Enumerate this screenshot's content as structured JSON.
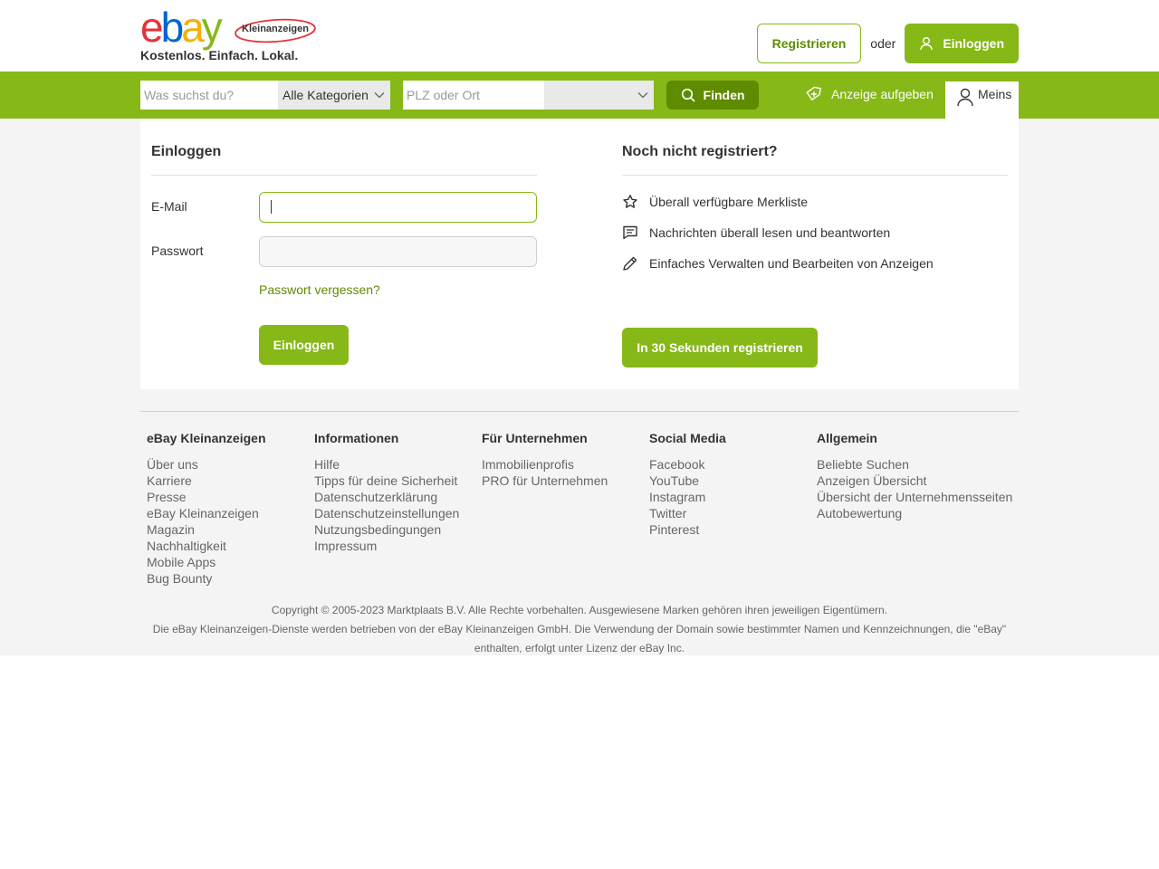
{
  "header": {
    "logo_text": [
      "e",
      "b",
      "a",
      "y"
    ],
    "logo_badge": "Kleinanzeigen",
    "tagline": "Kostenlos. Einfach. Lokal.",
    "register_label": "Registrieren",
    "or_label": "oder",
    "login_label": "Einloggen"
  },
  "nav": {
    "search_placeholder": "Was suchst du?",
    "category_value": "Alle Kategorien",
    "location_placeholder": "PLZ oder Ort",
    "radius_value": "",
    "find_label": "Finden",
    "post_ad_label": "Anzeige aufgeben",
    "meins_label": "Meins"
  },
  "login": {
    "title": "Einloggen",
    "email_label": "E-Mail",
    "email_value": "",
    "password_label": "Passwort",
    "password_value": "",
    "forgot_label": "Passwort vergessen?",
    "submit_label": "Einloggen"
  },
  "register": {
    "title": "Noch nicht registriert?",
    "features": [
      {
        "icon": "star-icon",
        "label": "Überall verfügbare Merkliste"
      },
      {
        "icon": "message-icon",
        "label": "Nachrichten überall lesen und beantworten"
      },
      {
        "icon": "pencil-icon",
        "label": "Einfaches Verwalten und Bearbeiten von Anzeigen"
      }
    ],
    "submit_label": "In 30 Sekunden registrieren"
  },
  "footer": {
    "columns": [
      {
        "title": "eBay Kleinanzeigen",
        "links": [
          "Über uns",
          "Karriere",
          "Presse",
          "eBay Kleinanzeigen",
          "Magazin",
          "Nachhaltigkeit",
          "Mobile Apps",
          "Bug Bounty"
        ]
      },
      {
        "title": "Informationen",
        "links": [
          "Hilfe",
          "Tipps für deine Sicherheit",
          "Datenschutzerklärung",
          "Datenschutzeinstellungen",
          "Nutzungsbedingungen",
          "Impressum"
        ]
      },
      {
        "title": "Für Unternehmen",
        "links": [
          "Immobilienprofis",
          "PRO für Unternehmen"
        ]
      },
      {
        "title": "Social Media",
        "links": [
          "Facebook",
          "YouTube",
          "Instagram",
          "Twitter",
          "Pinterest"
        ]
      },
      {
        "title": "Allgemein",
        "links": [
          "Beliebte Suchen",
          "Anzeigen Übersicht",
          "Übersicht der Unternehmensseiten",
          "Autobewertung"
        ]
      }
    ],
    "copyright_line1": "Copyright © 2005-2023 Marktplaats B.V. Alle Rechte vorbehalten. Ausgewiesene Marken gehören ihren jeweiligen Eigentümern.",
    "copyright_line2": "Die eBay Kleinanzeigen-Dienste werden betrieben von der eBay Kleinanzeigen GmbH. Die Verwendung der Domain sowie bestimmter Namen und Kennzeichnungen, die \"eBay\" enthalten, erfolgt unter Lizenz der eBay Inc."
  },
  "colors": {
    "brand_green": "#86b817",
    "dark_green": "#5f8b00",
    "logo_red": "#e53238",
    "logo_blue": "#0064d2",
    "logo_yellow": "#f5af02",
    "logo_green": "#86b817"
  }
}
